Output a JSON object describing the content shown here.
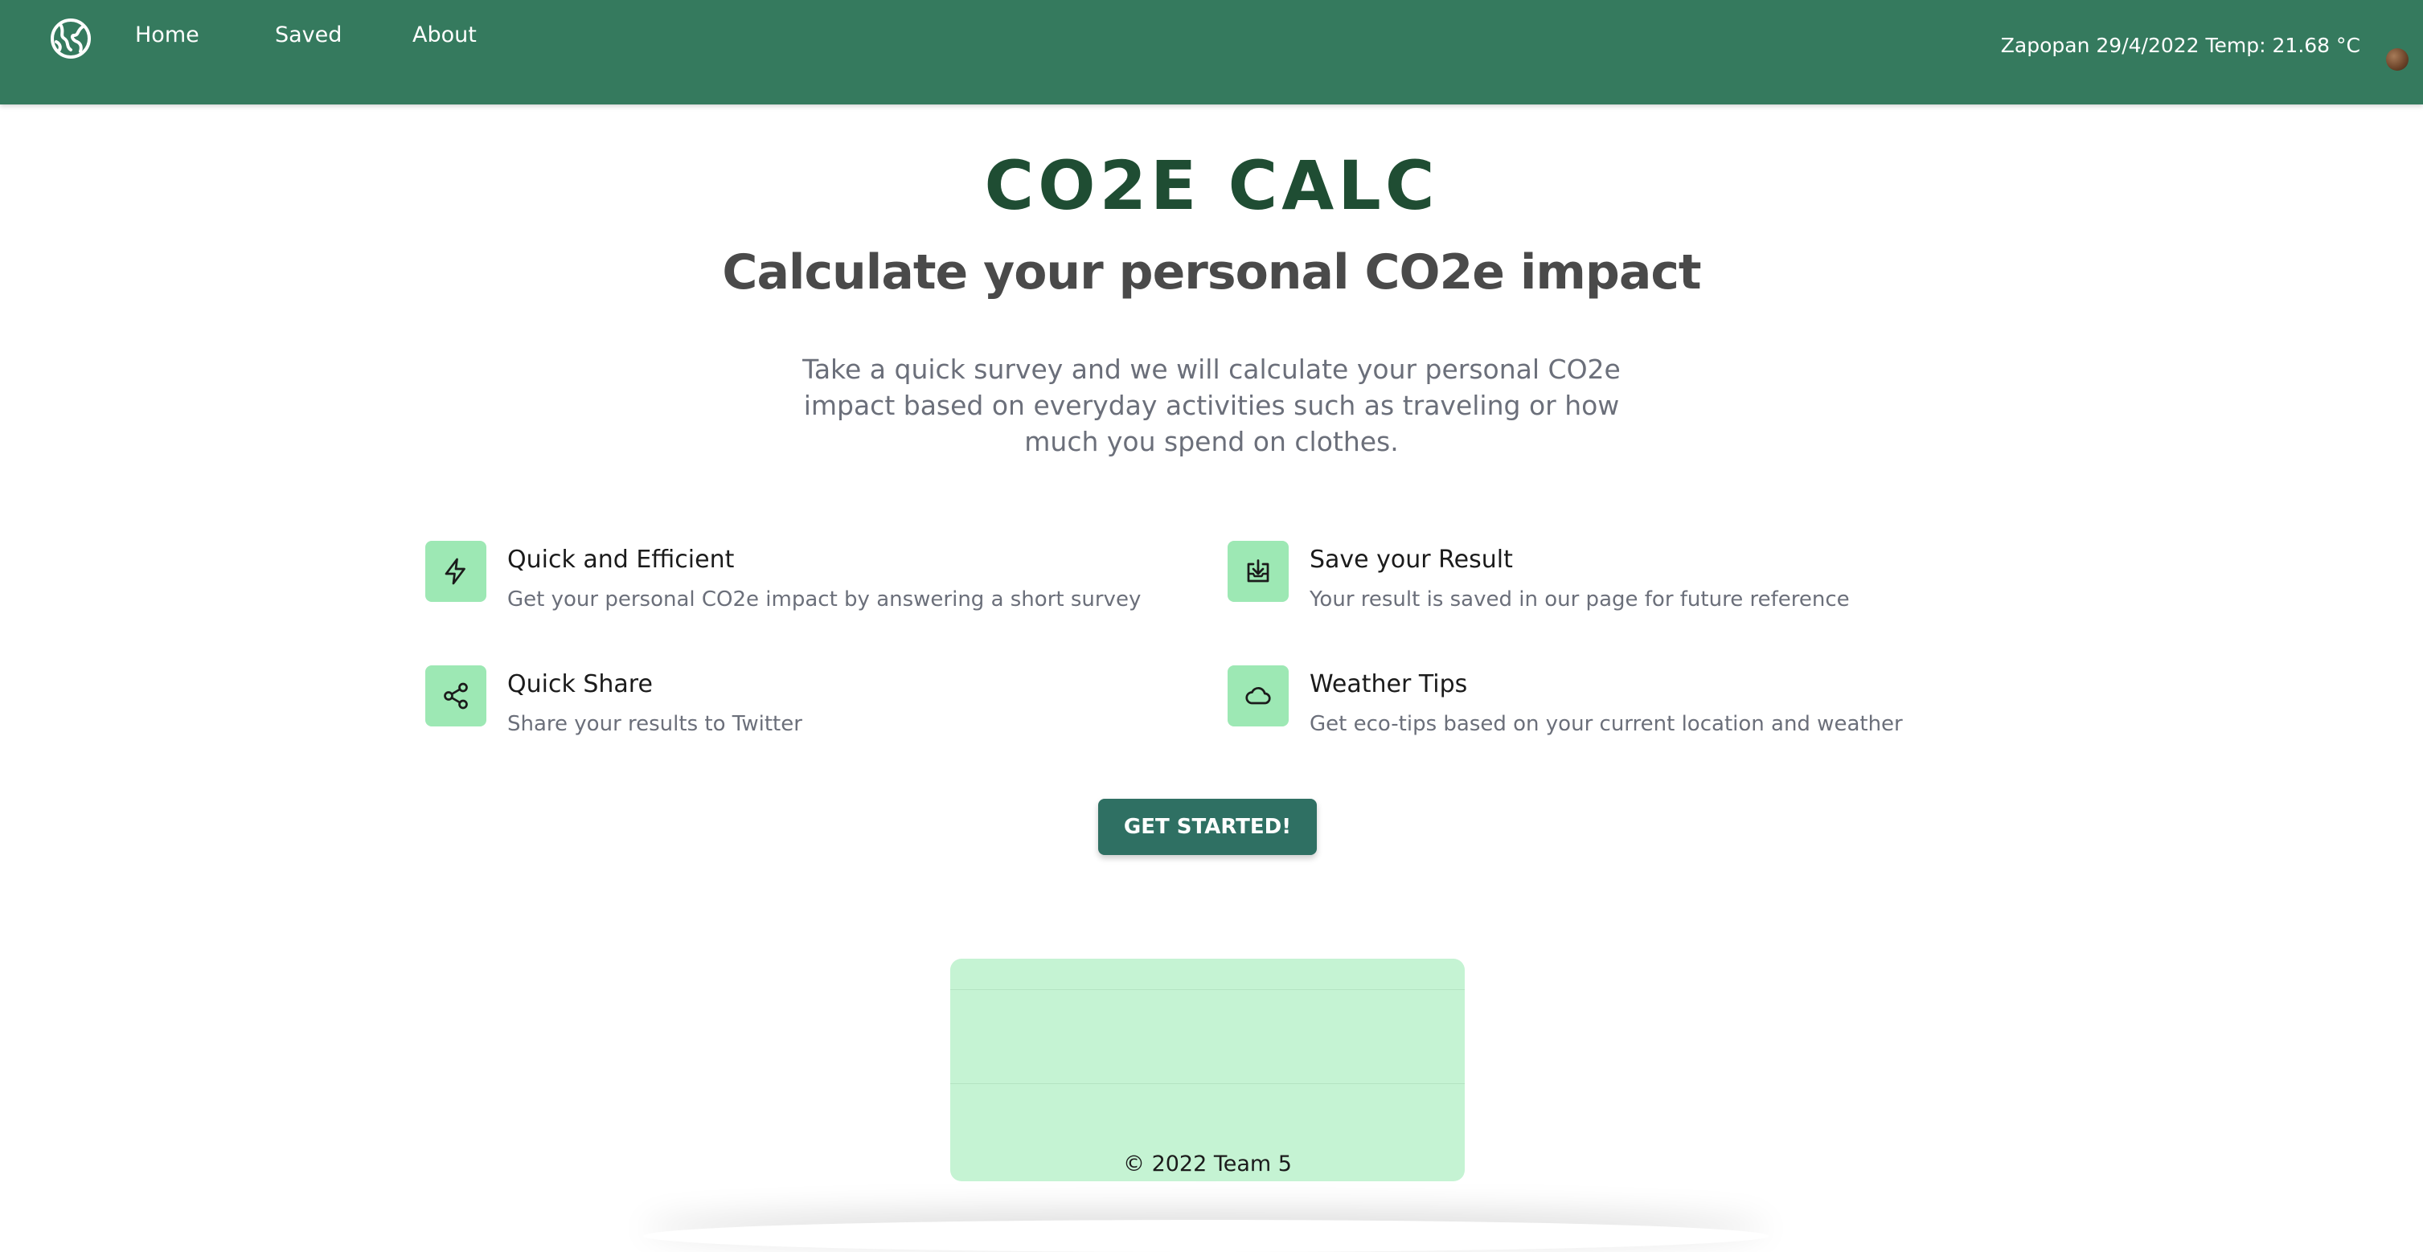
{
  "header": {
    "nav": [
      {
        "label": "Home"
      },
      {
        "label": "Saved"
      },
      {
        "label": "About"
      }
    ],
    "weather_status": "Zapopan 29/4/2022 Temp: 21.68 °C",
    "logo_icon": "globe-logo-icon",
    "avatar_icon": "avatar"
  },
  "hero": {
    "brand": "CO2E CALC",
    "title": "Calculate your personal CO2e impact",
    "intro": "Take a quick survey and we will calculate your personal CO2e impact based on everyday activities such as traveling or how much you spend on clothes."
  },
  "features": [
    {
      "title": "Quick and Efficient",
      "desc": "Get your personal CO2e impact by answering a short survey",
      "icon": "lightning-icon"
    },
    {
      "title": "Save your Result",
      "desc": "Your result is saved in our page for future reference",
      "icon": "download-tray-icon"
    },
    {
      "title": "Quick Share",
      "desc": "Share your results to Twitter",
      "icon": "share-icon"
    },
    {
      "title": "Weather Tips",
      "desc": "Get eco-tips based on your current location and weather",
      "icon": "cloud-icon"
    }
  ],
  "cta": {
    "label": "GET STARTED!"
  },
  "footer": {
    "copyright": "© 2022 Team 5"
  },
  "colors": {
    "header_bg": "#357a5e",
    "brand_text": "#1f4d33",
    "icon_bg": "#9de8b4",
    "cta_bg": "#2f7063",
    "footer_bg": "#c5f3d3"
  }
}
